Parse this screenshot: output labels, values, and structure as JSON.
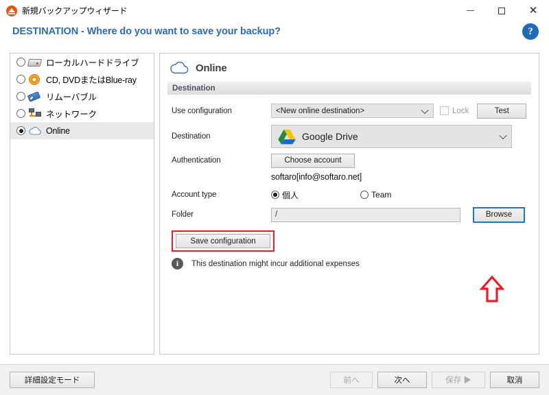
{
  "window": {
    "title": "新規バックアップウィザード",
    "app_icon": "eject-orange-icon",
    "minimize": "–",
    "maximize": "□",
    "close": "✕"
  },
  "header": {
    "page_title": "DESTINATION - Where do you want to save your backup?",
    "help_label": "?",
    "accent_color": "#2e6bb0"
  },
  "sidebar": {
    "items": [
      {
        "label": "ローカルハードドライブ",
        "icon": "hard-drive-icon",
        "selected": false
      },
      {
        "label": "CD, DVDまたはBlue-ray",
        "icon": "optical-disc-icon",
        "selected": false
      },
      {
        "label": "リムーバブル",
        "icon": "usb-drive-icon",
        "selected": false
      },
      {
        "label": "ネットワーク",
        "icon": "network-icon",
        "selected": false
      },
      {
        "label": "Online",
        "icon": "cloud-icon",
        "selected": true
      }
    ]
  },
  "panel": {
    "title": "Online",
    "icon": "cloud-icon",
    "section_header": "Destination",
    "rows": {
      "use_configuration": {
        "label": "Use configuration",
        "value": "<New online destination>",
        "lock_label": "Lock",
        "lock_checked": false,
        "test_label": "Test"
      },
      "destination": {
        "label": "Destination",
        "value": "Google Drive",
        "icon": "google-drive-logo"
      },
      "authentication": {
        "label": "Authentication",
        "choose_account_label": "Choose account",
        "account": "softaro[info@softaro.net]"
      },
      "account_type": {
        "label": "Account type",
        "options": [
          {
            "label": "個人",
            "selected": true
          },
          {
            "label": "Team",
            "selected": false
          }
        ]
      },
      "folder": {
        "label": "Folder",
        "value": "/",
        "browse_label": "Browse"
      }
    },
    "save_configuration_label": "Save configuration",
    "note": "This destination might incur additional expenses",
    "note_icon": "info-icon",
    "annotation_color": "#ed1c24"
  },
  "bottom_bar": {
    "advanced_label": "詳細設定モード",
    "prev_label": "前へ",
    "next_label": "次へ",
    "save_label": "保存 ▶",
    "cancel_label": "取消"
  }
}
